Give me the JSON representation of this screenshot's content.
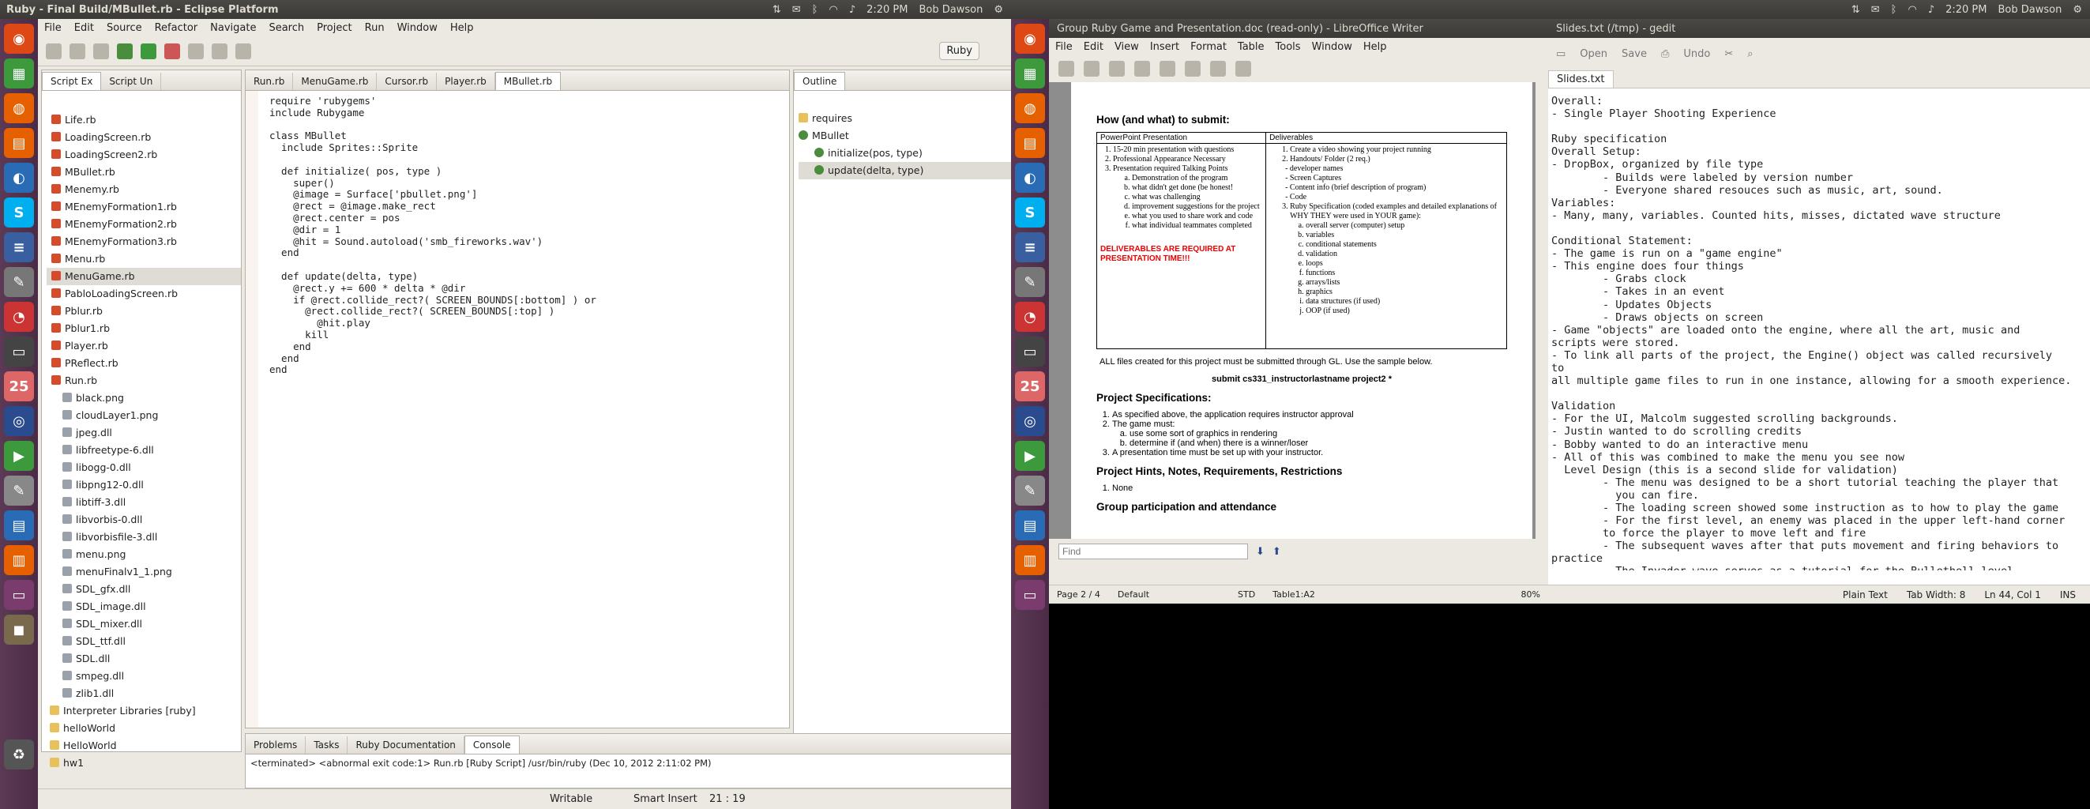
{
  "left": {
    "window_title": "Ruby - Final Build/MBullet.rb - Eclipse Platform",
    "time": "2:20 PM",
    "user": "Bob Dawson",
    "menu": [
      "File",
      "Edit",
      "Source",
      "Refactor",
      "Navigate",
      "Search",
      "Project",
      "Run",
      "Window",
      "Help"
    ],
    "perspective": "Ruby",
    "explorer_tabs": [
      "Script Ex",
      "Script Un"
    ],
    "files": [
      "Life.rb",
      "LoadingScreen.rb",
      "LoadingScreen2.rb",
      "MBullet.rb",
      "Menemy.rb",
      "MEnemyFormation1.rb",
      "MEnemyFormation2.rb",
      "MEnemyFormation3.rb",
      "Menu.rb",
      "MenuGame.rb",
      "PabloLoadingScreen.rb",
      "Pblur.rb",
      "Pblur1.rb",
      "Player.rb",
      "PReflect.rb",
      "Run.rb",
      "black.png",
      "cloudLayer1.png",
      "jpeg.dll",
      "libfreetype-6.dll",
      "libogg-0.dll",
      "libpng12-0.dll",
      "libtiff-3.dll",
      "libvorbis-0.dll",
      "libvorbisfile-3.dll",
      "menu.png",
      "menuFinalv1_1.png",
      "SDL_gfx.dll",
      "SDL_image.dll",
      "SDL_mixer.dll",
      "SDL_ttf.dll",
      "SDL.dll",
      "smpeg.dll",
      "zlib1.dll",
      "Interpreter Libraries [ruby]",
      "helloWorld",
      "HelloWorld",
      "hw1"
    ],
    "editor_tabs": [
      "Run.rb",
      "MenuGame.rb",
      "Cursor.rb",
      "Player.rb",
      "MBullet.rb"
    ],
    "code": "require 'rubygems'\ninclude Rubygame\n\nclass MBullet\n  include Sprites::Sprite\n\n  def initialize( pos, type )\n    super()\n    @image = Surface['pbullet.png']\n    @rect = @image.make_rect\n    @rect.center = pos\n    @dir = 1\n    @hit = Sound.autoload('smb_fireworks.wav')\n  end\n\n  def update(delta, type)\n    @rect.y += 600 * delta * @dir\n    if @rect.collide_rect?( SCREEN_BOUNDS[:bottom] ) or\n      @rect.collide_rect?( SCREEN_BOUNDS[:top] )\n        @hit.play\n      kill\n    end\n  end\nend",
    "outline_title": "Outline",
    "outline": [
      "requires",
      "MBullet",
      "initialize(pos, type)",
      "update(delta, type)"
    ],
    "bottom_tabs": [
      "Problems",
      "Tasks",
      "Ruby Documentation",
      "Console"
    ],
    "console_line": "<terminated> <abnormal exit code:1> Run.rb [Ruby Script] /usr/bin/ruby (Dec 10, 2012 2:11:02 PM)",
    "status": {
      "writable": "Writable",
      "insert": "Smart Insert",
      "pos": "21 : 19"
    }
  },
  "writer": {
    "title": "Group Ruby Game and Presentation.doc (read-only) - LibreOffice Writer",
    "menu": [
      "File",
      "Edit",
      "View",
      "Insert",
      "Format",
      "Table",
      "Tools",
      "Window",
      "Help"
    ],
    "heading1": "How (and what) to submit:",
    "col1": "PowerPoint Presentation",
    "col2": "Deliverables",
    "pp_items": [
      "15-20 min presentation with questions",
      "Professional Appearance Necessary",
      "Presentation required Talking Points"
    ],
    "pp_sub": [
      "Demonstration of the program",
      "what didn't get done (be honest!",
      "what was challenging",
      "improvement suggestions for the project",
      "what you used to share work and code",
      "what individual teammates completed"
    ],
    "red_note": "DELIVERABLES ARE REQUIRED AT PRESENTATION TIME!!!",
    "del_items": [
      "Create a video showing your project running",
      "Handouts/ Folder (2 req.)",
      "Ruby Specification (coded examples and detailed explanations of WHY THEY were used in YOUR game):"
    ],
    "del_sub1": [
      "- developer names",
      "- Screen Captures",
      "- Content info (brief description of program)",
      "- Code"
    ],
    "del_sub2": [
      "overall server (computer) setup",
      "variables",
      "conditional statements",
      "validation",
      "loops",
      "functions",
      "arrays/lists",
      "graphics",
      "data structures (if used)",
      "OOP (if used)"
    ],
    "all_files": "ALL files created for this project  must be submitted through GL. Use the sample below.",
    "submit_cmd": "submit cs331_instructorlastname project2 *",
    "heading2": "Project Specifications:",
    "spec1": "As specified above, the application requires instructor approval",
    "spec2": "The game must:",
    "spec2a": "use some sort of graphics in rendering",
    "spec2b": "determine if  (and when) there is a winner/loser",
    "spec3": "A presentation time must be set up with your instructor.",
    "heading3": "Project Hints, Notes, Requirements, Restrictions",
    "none": "None",
    "heading4": "Group participation and attendance",
    "find_placeholder": "Find",
    "status": {
      "page": "Page 2 / 4",
      "style": "Default",
      "lang": "STD",
      "table": "Table1:A2",
      "zoom": "80%"
    }
  },
  "gedit": {
    "title": "Slides.txt (/tmp) - gedit",
    "toolbar": [
      "Open",
      "Save",
      "Undo"
    ],
    "tab": "Slides.txt",
    "text": "Overall:\n- Single Player Shooting Experience\n\nRuby specification\nOverall Setup:\n- DropBox, organized by file type\n        - Builds were labeled by version number\n        - Everyone shared resouces such as music, art, sound.\nVariables:\n- Many, many, variables. Counted hits, misses, dictated wave structure\n\nConditional Statement:\n- The game is run on a \"game engine\"\n- This engine does four things\n        - Grabs clock\n        - Takes in an event\n        - Updates Objects\n        - Draws objects on screen\n- Game \"objects\" are loaded onto the engine, where all the art, music and\nscripts were stored.\n- To link all parts of the project, the Engine() object was called recursively\nto\nall multiple game files to run in one instance, allowing for a smooth experience.\n\nValidation\n- For the UI, Malcolm suggested scrolling backgrounds.\n- Justin wanted to do scrolling credits\n- Bobby wanted to do an interactive menu\n- All of this was combined to make the menu you see now\n  Level Design (this is a second slide for validation)\n        - The menu was designed to be a short tutorial teaching the player that\n          you can fire.\n        - The loading screen showed some instruction as to how to play the game\n        - For the first level, an enemy was placed in the upper left-hand corner\n        to force the player to move left and fire\n        - The subsequent waves after that puts movement and firing behaviors to\npractice\n        - The Invader wave serves as a tutorial for the Bullethell level",
    "status": {
      "lang": "Plain Text",
      "tab": "Tab Width: 8",
      "pos": "Ln 44, Col 1",
      "mode": "INS"
    }
  }
}
